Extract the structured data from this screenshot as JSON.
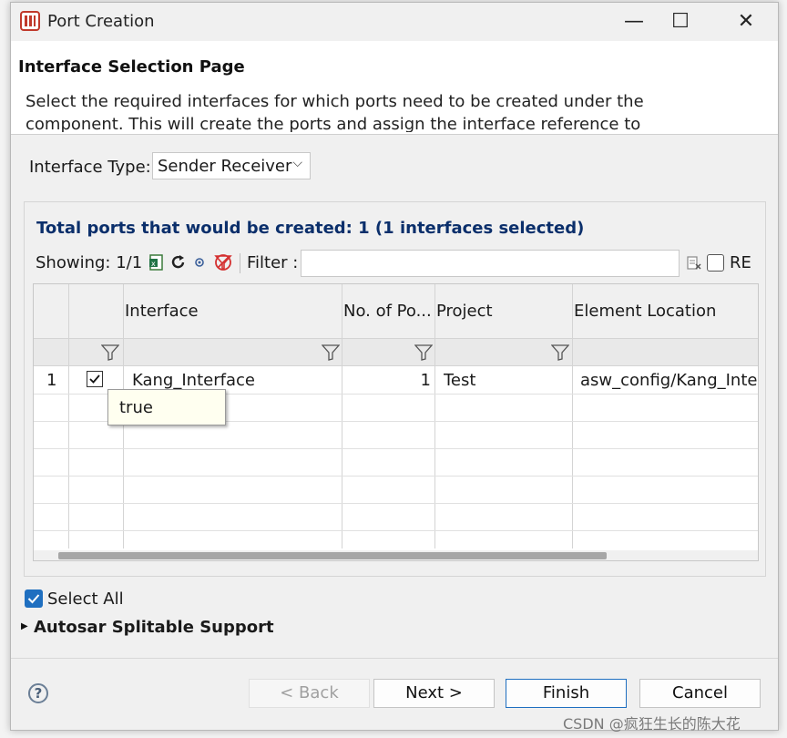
{
  "window": {
    "title": "Port Creation",
    "minimize_glyph": "—",
    "maximize_glyph": "☐",
    "close_glyph": "✕"
  },
  "header": {
    "page_title": "Interface Selection Page",
    "description": "Select the required interfaces for which ports need to be created under the component. This will create the ports and assign the interface reference to the"
  },
  "interface_type": {
    "label": "Interface Type:",
    "value": "Sender Receiver"
  },
  "summary": {
    "total_text": "Total ports that would be created: 1 (1 interfaces selected)"
  },
  "toolbar": {
    "showing": "Showing: 1/1",
    "filter_label": "Filter :",
    "filter_value": "",
    "re_label": "RE",
    "re_checked": false
  },
  "table": {
    "columns": [
      "",
      "",
      "Interface",
      "No. of Po...",
      "Project",
      "Element Location"
    ],
    "rows": [
      {
        "index": "1",
        "selected": true,
        "interface": "Kang_Interface",
        "ports": "1",
        "project": "Test",
        "location": "asw_config/Kang_Inter"
      }
    ]
  },
  "tooltip": {
    "text": "true"
  },
  "select_all": {
    "label": "Select All",
    "checked": true
  },
  "autosar": {
    "label": "Autosar Splitable Support"
  },
  "buttons": {
    "back": "< Back",
    "next": "Next >",
    "finish": "Finish",
    "cancel": "Cancel"
  },
  "help_glyph": "?",
  "watermark": "CSDN @疯狂生长的陈大花",
  "colors": {
    "accent": "#1f6fc0",
    "summary_text": "#0b2f6b"
  }
}
